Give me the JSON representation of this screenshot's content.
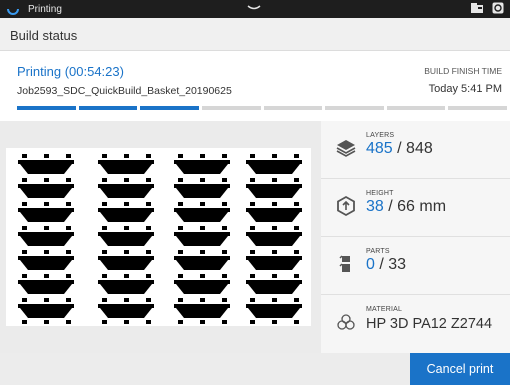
{
  "statusbar": {
    "app_name": "Printing"
  },
  "header": {
    "title": "Build status"
  },
  "job": {
    "state": "Printing (00:54:23)",
    "name": "Job2593_SDC_QuickBuild_Basket_20190625",
    "finish_label": "BUILD FINISH TIME",
    "finish_time": "Today 5:41 PM",
    "progress_segments_total": 8,
    "progress_segments_done": 3
  },
  "stats": {
    "layers": {
      "label": "LAYERS",
      "current": "485",
      "total": "/ 848"
    },
    "height": {
      "label": "HEIGHT",
      "current": "38",
      "total": "/ 66 mm"
    },
    "parts": {
      "label": "PARTS",
      "current": "0",
      "total": "/ 33"
    },
    "material": {
      "label": "MATERIAL",
      "value": "HP 3D PA12 Z2744"
    }
  },
  "actions": {
    "cancel_label": "Cancel print"
  },
  "colors": {
    "accent": "#1a73c8",
    "statusbar": "#1e1e1e"
  },
  "icons": [
    "printing-icon",
    "chevron-down-icon",
    "folder-icon",
    "refresh-icon",
    "layers-icon",
    "height-icon",
    "parts-icon",
    "material-icon"
  ]
}
